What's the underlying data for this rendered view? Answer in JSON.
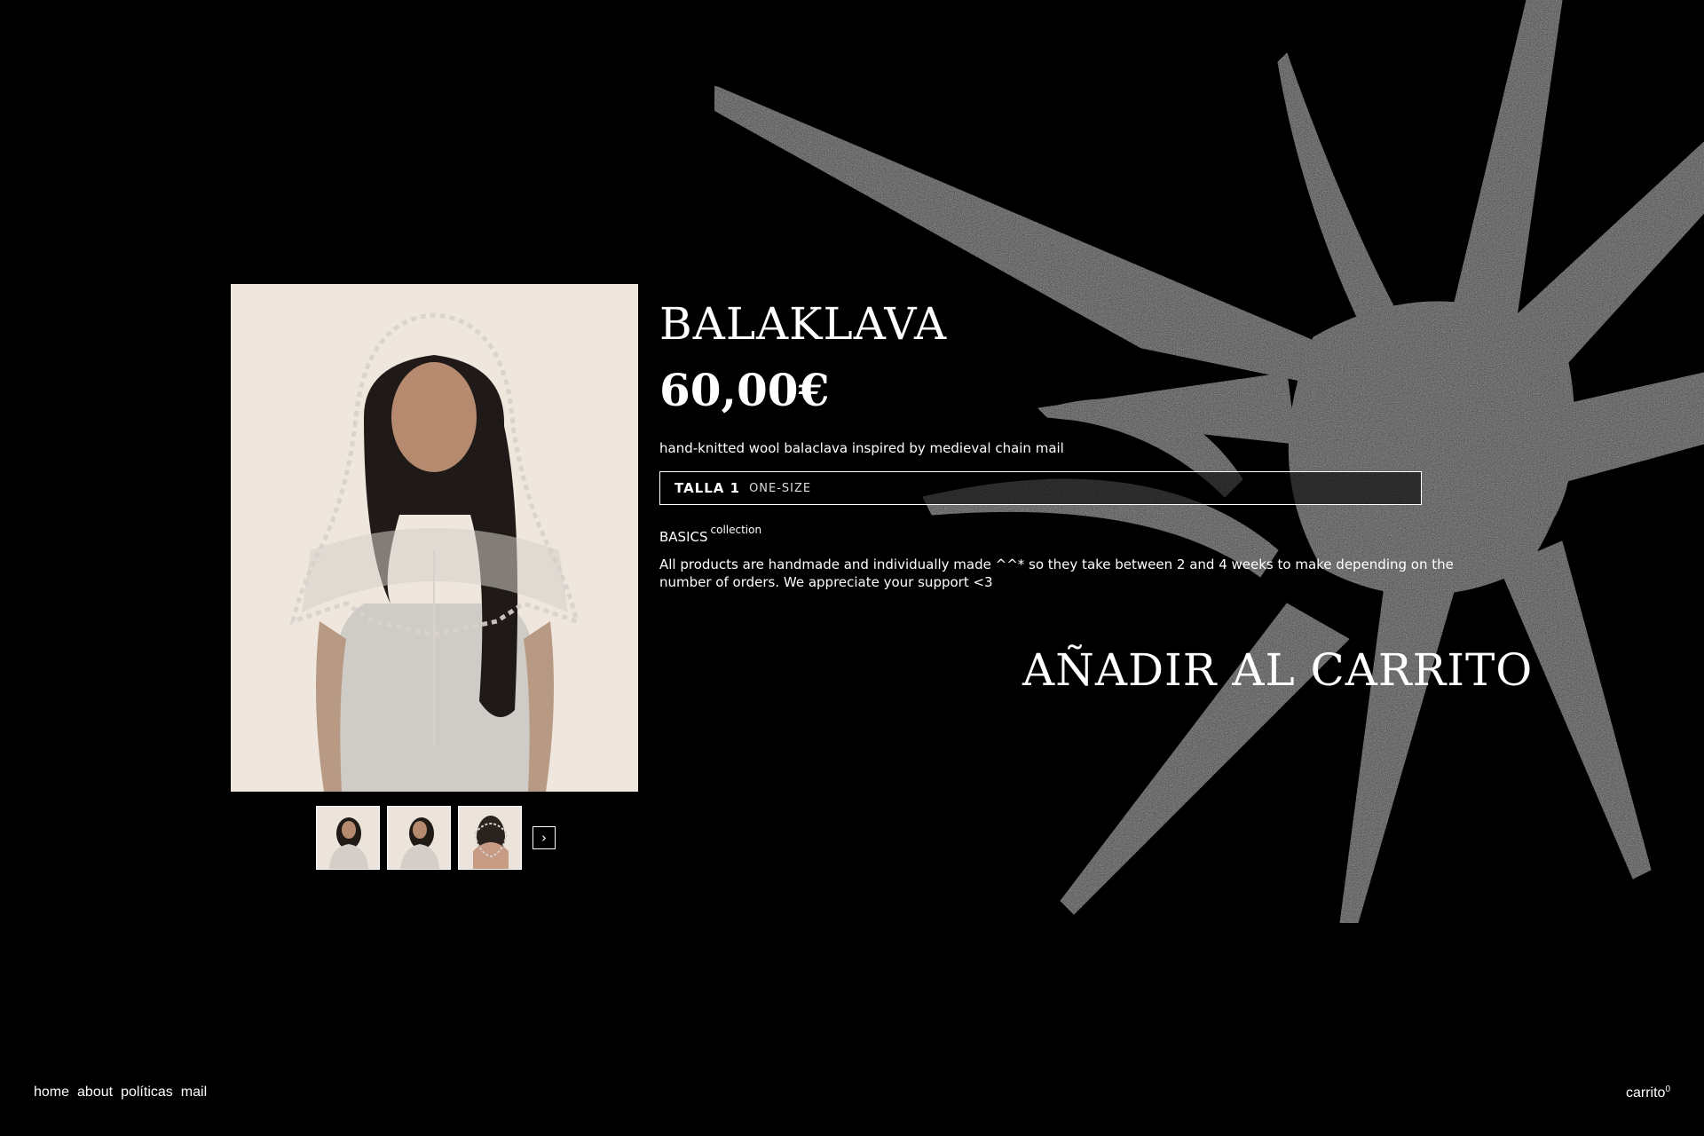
{
  "product": {
    "title": "BALAKLAVA",
    "price": "60,00€",
    "description": "hand-knitted wool balaclava inspired by medieval chain mail",
    "size": {
      "label": "TALLA 1",
      "value": "ONE-SIZE"
    },
    "collection": {
      "name": "BASICS",
      "suffix": "collection"
    },
    "notice": "All products are handmade and individually made ^^* so they take between 2 and 4 weeks to make depending on the number of orders. We appreciate your support <3",
    "add_to_cart_label": "AÑADIR AL CARRITO",
    "next_icon": "›"
  },
  "footer": {
    "nav": [
      "home",
      "about",
      "políticas",
      "mail"
    ],
    "cart_label": "carrito",
    "cart_count": "0"
  },
  "colors": {
    "background": "#000000",
    "text": "#ffffff",
    "star": "#3a3a3a"
  },
  "icons": {
    "next": "chevron-right-icon",
    "decoration": "star-icon"
  }
}
